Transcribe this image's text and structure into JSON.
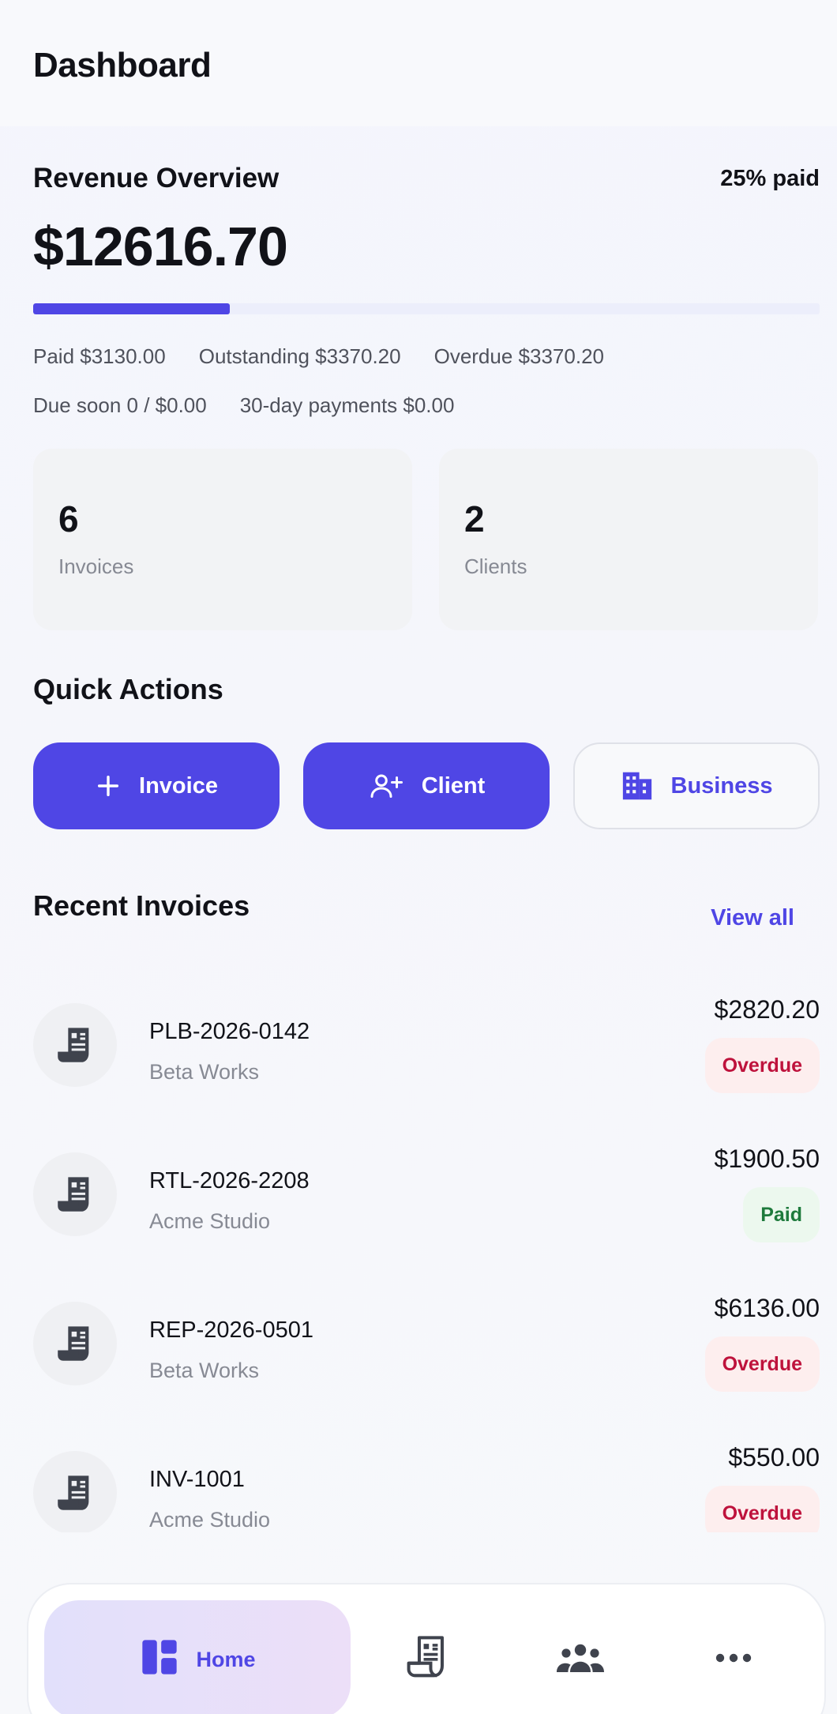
{
  "header": {
    "title": "Dashboard"
  },
  "revenue": {
    "title": "Revenue Overview",
    "paid_percent_label": "25% paid",
    "paid_fraction": 0.25,
    "total": "$12616.70",
    "stats_row1": [
      "Paid $3130.00",
      "Outstanding $3370.20",
      "Overdue $3370.20"
    ],
    "stats_row2": [
      "Due soon 0 / $0.00",
      "30-day payments $0.00"
    ]
  },
  "summary_cards": [
    {
      "value": "6",
      "label": "Invoices"
    },
    {
      "value": "2",
      "label": "Clients"
    }
  ],
  "quick_actions": {
    "title": "Quick Actions",
    "buttons": [
      {
        "label": "Invoice",
        "icon": "plus-icon"
      },
      {
        "label": "Client",
        "icon": "add-person-icon"
      },
      {
        "label": "Business",
        "icon": "building-icon"
      }
    ]
  },
  "recent_invoices": {
    "title": "Recent Invoices",
    "view_all_label": "View all",
    "items": [
      {
        "number": "PLB-2026-0142",
        "client": "Beta Works",
        "amount": "$2820.20",
        "status": "Overdue",
        "status_color": "#be123c"
      },
      {
        "number": "RTL-2026-2208",
        "client": "Acme Studio",
        "amount": "$1900.50",
        "status": "Paid",
        "status_color": "#1e7a3c"
      },
      {
        "number": "REP-2026-0501",
        "client": "Beta Works",
        "amount": "$6136.00",
        "status": "Overdue",
        "status_color": "#be123c"
      },
      {
        "number": "INV-1001",
        "client": "Acme Studio",
        "amount": "$550.00",
        "status": "Overdue",
        "status_color": "#be123c"
      }
    ]
  },
  "bottom_nav": {
    "items": [
      {
        "label": "Home",
        "icon": "dashboard-icon",
        "active": true
      },
      {
        "label": "",
        "icon": "receipt-icon"
      },
      {
        "label": "",
        "icon": "group-icon"
      },
      {
        "label": "",
        "icon": "more-icon"
      }
    ]
  },
  "colors": {
    "accent": "#4f46e5",
    "overdue": "#be123c",
    "paid": "#1e7a3c"
  }
}
